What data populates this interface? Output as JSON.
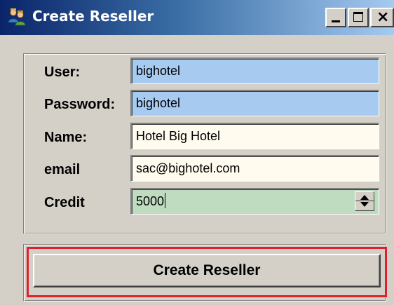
{
  "window": {
    "title": "Create Reseller",
    "icon": "users-icon",
    "controls": {
      "minimize": "minimize-icon",
      "maximize": "maximize-icon",
      "close": "×"
    }
  },
  "form": {
    "fields": [
      {
        "label": "User:",
        "value": "bighotel"
      },
      {
        "label": "Password:",
        "value": "bighotel"
      },
      {
        "label": "Name:",
        "value": "Hotel Big Hotel"
      },
      {
        "label": "email",
        "value": "sac@bighotel.com"
      },
      {
        "label": "Credit",
        "value": "5000"
      }
    ],
    "field_colors": {
      "user": "#a6caf0",
      "password": "#a6caf0",
      "name": "#fffbee",
      "email": "#fffbee",
      "credit": "#c0dcc0"
    }
  },
  "actions": {
    "create_label": "Create Reseller",
    "highlight_color": "#e0202c"
  }
}
